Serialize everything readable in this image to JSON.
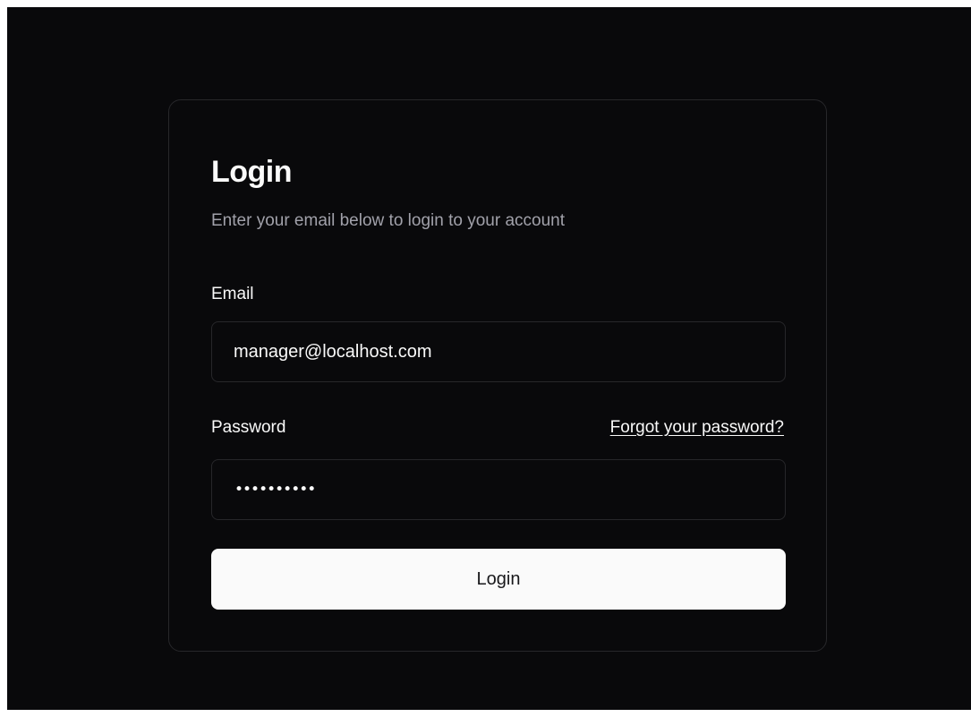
{
  "login_card": {
    "title": "Login",
    "subtitle": "Enter your email below to login to your account",
    "email": {
      "label": "Email",
      "value": "manager@localhost.com"
    },
    "password": {
      "label": "Password",
      "masked_value": "••••••••••",
      "forgot_link": "Forgot your password?"
    },
    "submit_label": "Login"
  },
  "colors": {
    "background": "#09090b",
    "card_border": "#27272a",
    "text_primary": "#fafafa",
    "text_muted": "#a1a1aa",
    "button_bg": "#fafafa",
    "button_text": "#18181b"
  }
}
